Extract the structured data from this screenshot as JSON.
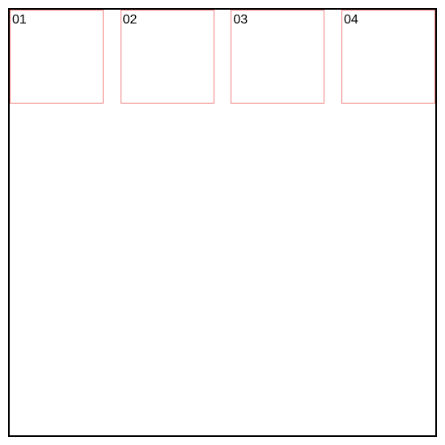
{
  "boxes": [
    {
      "label": "01"
    },
    {
      "label": "02"
    },
    {
      "label": "03"
    },
    {
      "label": "04"
    }
  ]
}
